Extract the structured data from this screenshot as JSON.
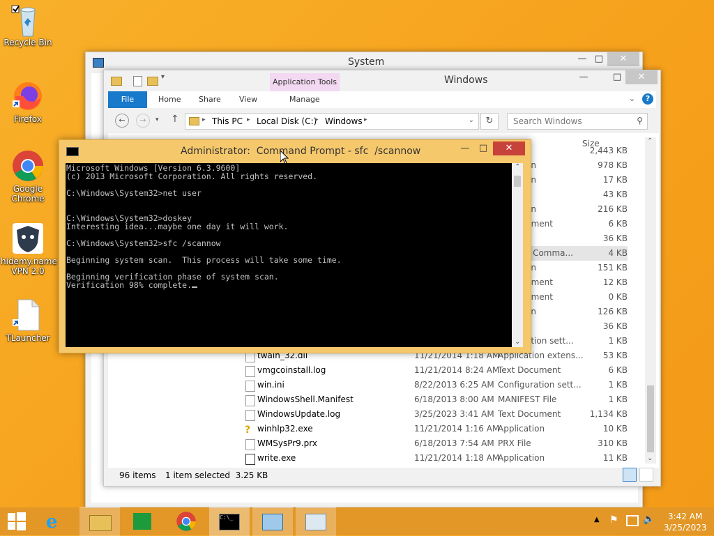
{
  "desktop": {
    "icons": [
      {
        "label": "Recycle Bin"
      },
      {
        "label": "Firefox"
      },
      {
        "label": "Google Chrome"
      },
      {
        "label": "hidemy.name VPN 2.0"
      },
      {
        "label": "TLauncher"
      }
    ]
  },
  "system_window": {
    "title": "System"
  },
  "explorer": {
    "title": "Windows",
    "contextual_tab_group": "Application Tools",
    "tabs": [
      "File",
      "Home",
      "Share",
      "View",
      "Manage"
    ],
    "breadcrumb": [
      "This PC",
      "Local Disk (C:)",
      "Windows"
    ],
    "search_placeholder": "Search Windows",
    "size_header": "Size",
    "partial_rows": [
      {
        "prefix": "",
        "size": "2,443 KB"
      },
      {
        "prefix": "on",
        "size": "978 KB"
      },
      {
        "prefix": "on",
        "size": "17 KB"
      },
      {
        "prefix": "",
        "size": "43 KB"
      },
      {
        "prefix": "on",
        "size": "216 KB"
      },
      {
        "prefix": "ument",
        "size": "6 KB"
      },
      {
        "prefix": "",
        "size": "36 KB"
      },
      {
        "prefix": "s Comma...",
        "size": "4 KB"
      },
      {
        "prefix": "on",
        "size": "151 KB"
      },
      {
        "prefix": "ument",
        "size": "12 KB"
      },
      {
        "prefix": "ument",
        "size": "0 KB"
      },
      {
        "prefix": "on",
        "size": "126 KB"
      },
      {
        "prefix": "",
        "size": "36 KB"
      },
      {
        "prefix": "ation sett...",
        "size": "1 KB"
      }
    ],
    "rows": [
      {
        "name": "twain_32.dll",
        "date": "11/21/2014 1:18 AM",
        "type": "Application extens...",
        "size": "53 KB"
      },
      {
        "name": "vmgcoinstall.log",
        "date": "11/21/2014 8:24 AM",
        "type": "Text Document",
        "size": "6 KB"
      },
      {
        "name": "win.ini",
        "date": "8/22/2013 6:25 AM",
        "type": "Configuration sett...",
        "size": "1 KB"
      },
      {
        "name": "WindowsShell.Manifest",
        "date": "6/18/2013 8:00 AM",
        "type": "MANIFEST File",
        "size": "1 KB"
      },
      {
        "name": "WindowsUpdate.log",
        "date": "3/25/2023 3:41 AM",
        "type": "Text Document",
        "size": "1,134 KB"
      },
      {
        "name": "winhlp32.exe",
        "date": "11/21/2014 1:16 AM",
        "type": "Application",
        "size": "10 KB"
      },
      {
        "name": "WMSysPr9.prx",
        "date": "6/18/2013 7:54 AM",
        "type": "PRX File",
        "size": "310 KB"
      },
      {
        "name": "write.exe",
        "date": "11/21/2014 1:18 AM",
        "type": "Application",
        "size": "11 KB"
      }
    ],
    "status_items": "96 items",
    "status_selected": "1 item selected  3.25 KB"
  },
  "cmd": {
    "title": "Administrator:  Command Prompt - sfc  /scannow",
    "lines": [
      "Microsoft Windows [Version 6.3.9600]",
      "(c) 2013 Microsoft Corporation. All rights reserved.",
      "",
      "C:\\Windows\\System32>net user",
      "",
      "",
      "C:\\Windows\\System32>doskey",
      "Interesting idea...maybe one day it will work.",
      "",
      "C:\\Windows\\System32>sfc /scannow",
      "",
      "Beginning system scan.  This process will take some time.",
      "",
      "Beginning verification phase of system scan.",
      "Verification 98% complete."
    ]
  },
  "taskbar": {
    "time": "3:42 AM",
    "date": "3/25/2023"
  }
}
